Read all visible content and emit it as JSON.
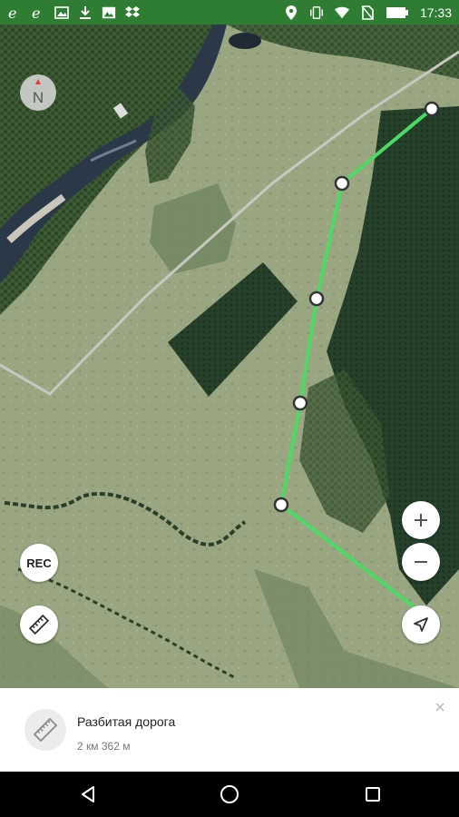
{
  "status_bar": {
    "time": "17:33",
    "left_icons": [
      "ie-browser-icon",
      "ie-browser-icon",
      "image-icon",
      "download-icon",
      "gallery-icon",
      "dropbox-icon"
    ],
    "right_icons": [
      "location-icon",
      "vibrate-icon",
      "wifi-icon",
      "no-sim-icon",
      "battery-icon"
    ]
  },
  "map": {
    "compass_label": "N",
    "rec_label": "REC",
    "route_color": "#4cd964"
  },
  "route_panel": {
    "title": "Разбитая дорога",
    "distance": "2 км 362 м"
  },
  "colors": {
    "status_bar": "#2e7d32",
    "route": "#4cd964"
  }
}
